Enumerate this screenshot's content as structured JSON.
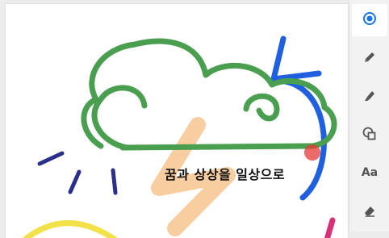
{
  "canvas": {
    "caption": "꿈과 상상을 일상으로"
  },
  "toolbar": {
    "active_tool": "select",
    "tools": [
      {
        "name": "select",
        "icon": "radio-target-icon"
      },
      {
        "name": "pen",
        "icon": "pen-icon"
      },
      {
        "name": "highlighter",
        "icon": "highlighter-icon"
      },
      {
        "name": "shapes",
        "icon": "shapes-icon"
      },
      {
        "name": "text",
        "icon": "text-icon",
        "label": "Aa"
      },
      {
        "name": "eraser",
        "icon": "eraser-icon"
      }
    ]
  },
  "colors": {
    "accent": "#1a73e8",
    "stroke_green": "#4a9e4f",
    "stroke_blue": "#1f5fe0",
    "stroke_navy": "#2b2f8a",
    "stroke_yellow": "#f3e14a",
    "stroke_peach": "#f7c48e",
    "stroke_magenta": "#d9307a",
    "dot_red": "#e53935"
  }
}
